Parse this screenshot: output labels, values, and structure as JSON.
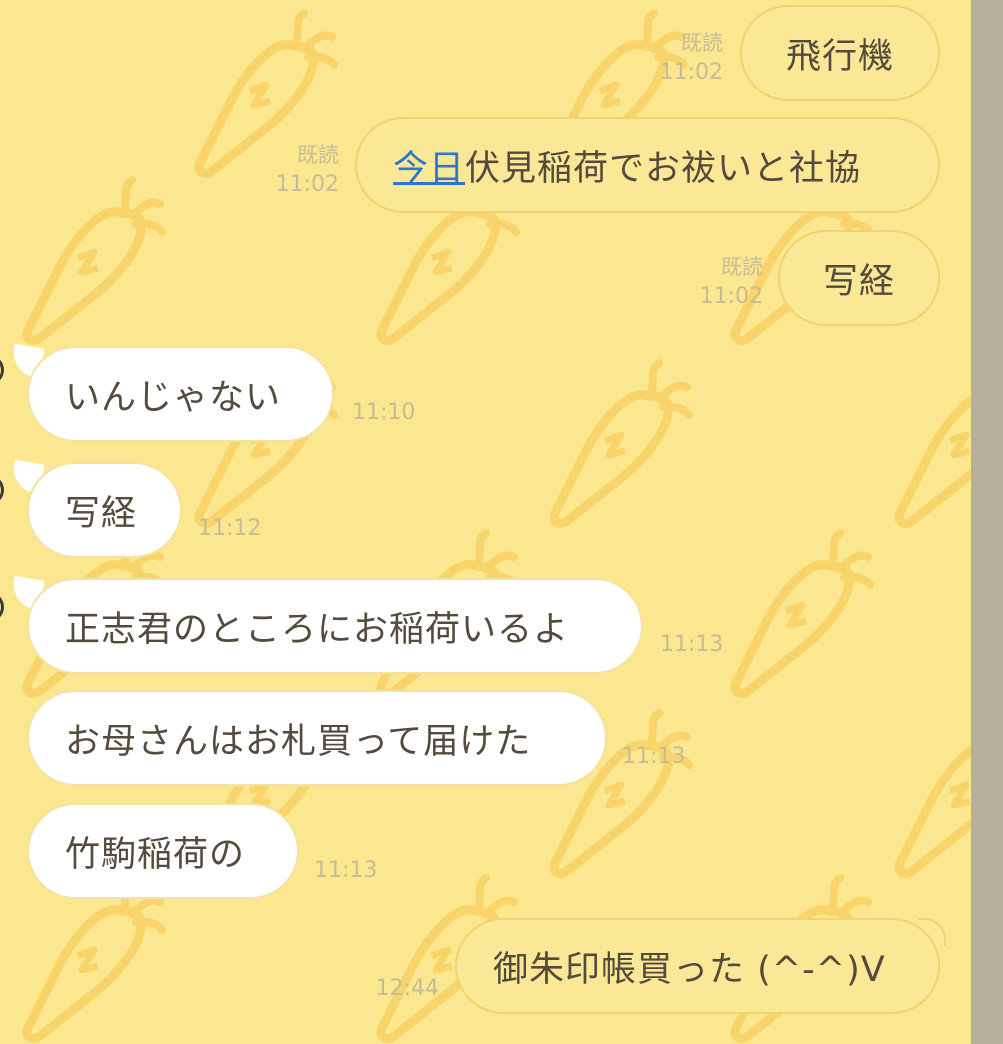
{
  "messages": [
    {
      "side": "out",
      "read_label": "既読",
      "time": "11:02",
      "text": "飛行機"
    },
    {
      "side": "out",
      "read_label": "既読",
      "time": "11:02",
      "link_text": "今日",
      "text_rest": "伏見稲荷でお祓いと社協"
    },
    {
      "side": "out",
      "read_label": "既読",
      "time": "11:02",
      "text": "写経"
    },
    {
      "side": "in",
      "time": "11:10",
      "text": "いんじゃない"
    },
    {
      "side": "in",
      "time": "11:12",
      "text": "写経"
    },
    {
      "side": "in",
      "time": "11:13",
      "text": "正志君のところにお稲荷いるよ"
    },
    {
      "side": "in",
      "time": "11:13",
      "text": "お母さんはお札買って届けた"
    },
    {
      "side": "in",
      "time": "11:13",
      "text": "竹駒稲荷の"
    },
    {
      "side": "out",
      "time": "12:44",
      "text": "御朱印帳買った (^-^)V"
    }
  ],
  "background": {
    "icon": "carrot-icon",
    "color": "#fbe78f",
    "icon_color": "#f9d46a"
  }
}
